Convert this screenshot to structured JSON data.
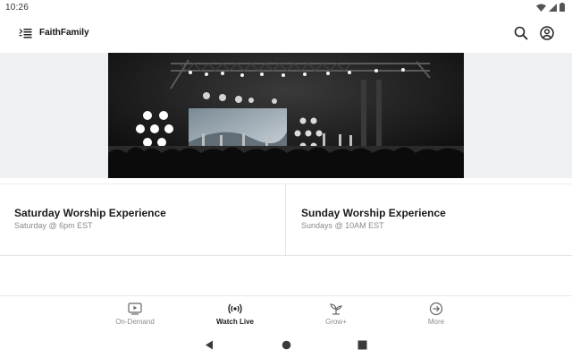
{
  "status_bar": {
    "time": "10:26",
    "icons": [
      "wifi-icon",
      "cell-signal-icon",
      "battery-icon"
    ]
  },
  "app_bar": {
    "logo_icon": "logo-icon",
    "title": "FaithFamily",
    "actions": [
      "search-icon",
      "account-icon"
    ]
  },
  "hero": {
    "image": "worship-stage-photo"
  },
  "cards": [
    {
      "title": "Saturday Worship Experience",
      "subtitle": "Saturday @ 6pm EST"
    },
    {
      "title": "Sunday Worship Experience",
      "subtitle": "Sundays @ 10AM EST"
    }
  ],
  "bottom_nav": {
    "items": [
      {
        "label": "On-Demand",
        "icon": "play-screen-icon",
        "active": false
      },
      {
        "label": "Watch Live",
        "icon": "broadcast-icon",
        "active": true
      },
      {
        "label": "Grow+",
        "icon": "sprout-icon",
        "active": false
      },
      {
        "label": "More",
        "icon": "arrow-circle-icon",
        "active": false
      }
    ]
  },
  "system_nav": [
    "back-icon",
    "home-icon",
    "recents-icon"
  ],
  "colors": {
    "text_primary": "#1a1a1a",
    "text_secondary": "#8a8a8a",
    "hero_band": "#eef0f2",
    "divider": "#e4e4e4"
  }
}
